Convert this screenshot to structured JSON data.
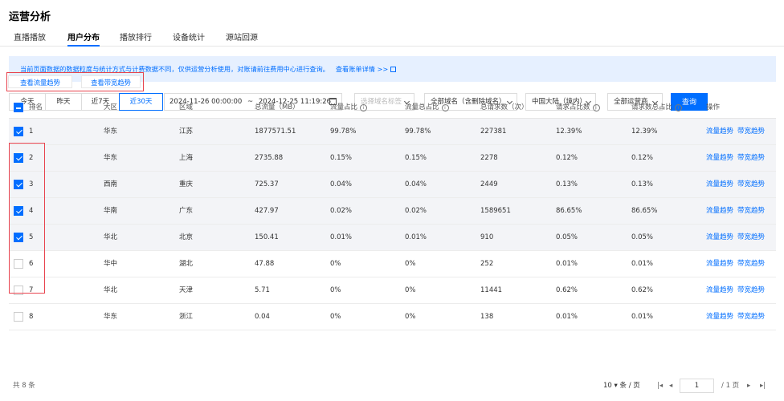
{
  "header": {
    "title": "运营分析",
    "tabs": [
      {
        "label": "直播播放",
        "active": false
      },
      {
        "label": "用户分布",
        "active": true
      },
      {
        "label": "播放排行",
        "active": false
      },
      {
        "label": "设备统计",
        "active": false
      },
      {
        "label": "源站回源",
        "active": false
      }
    ]
  },
  "notice": {
    "text": "当前页面数据的数据粒度与统计方式与计费数据不同，仅供运营分析使用，对账请前往费用中心进行查询。",
    "link": "查看账单详情 >>"
  },
  "filters": {
    "quick_ranges": [
      {
        "label": "今天",
        "active": false
      },
      {
        "label": "昨天",
        "active": false
      },
      {
        "label": "近7天",
        "active": false
      },
      {
        "label": "近30天",
        "active": true
      }
    ],
    "date_start": "2024-11-26 00:00:00",
    "date_sep": "~",
    "date_end": "2024-12-25 11:19:26",
    "tag_placeholder": "选择域名标签",
    "domain_select": "全部域名（含删除域名）",
    "region_select": "中国大陆（境内）",
    "isp_select": "全部运营商",
    "query_label": "查询"
  },
  "trend_buttons": {
    "traffic": "查看流量趋势",
    "bandwidth": "查看带宽趋势"
  },
  "table": {
    "columns": [
      "排名",
      "大区",
      "区域",
      "总流量（MB）",
      "流量占比",
      "流量总占比",
      "总请求数（次）",
      "请求占比数",
      "请求数总占比",
      "操作"
    ],
    "op_traffic": "流量趋势",
    "op_bandwidth": "带宽趋势",
    "info_glyph": "i",
    "rows": [
      {
        "rank": "1",
        "area": "华东",
        "region": "江苏",
        "traffic": "1877571.51",
        "traffic_ratio": "99.78%",
        "traffic_total_ratio": "99.78%",
        "requests": "227381",
        "req_ratio": "12.39%",
        "req_total_ratio": "12.39%",
        "checked": true
      },
      {
        "rank": "2",
        "area": "华东",
        "region": "上海",
        "traffic": "2735.88",
        "traffic_ratio": "0.15%",
        "traffic_total_ratio": "0.15%",
        "requests": "2278",
        "req_ratio": "0.12%",
        "req_total_ratio": "0.12%",
        "checked": true
      },
      {
        "rank": "3",
        "area": "西南",
        "region": "重庆",
        "traffic": "725.37",
        "traffic_ratio": "0.04%",
        "traffic_total_ratio": "0.04%",
        "requests": "2449",
        "req_ratio": "0.13%",
        "req_total_ratio": "0.13%",
        "checked": true
      },
      {
        "rank": "4",
        "area": "华南",
        "region": "广东",
        "traffic": "427.97",
        "traffic_ratio": "0.02%",
        "traffic_total_ratio": "0.02%",
        "requests": "1589651",
        "req_ratio": "86.65%",
        "req_total_ratio": "86.65%",
        "checked": true
      },
      {
        "rank": "5",
        "area": "华北",
        "region": "北京",
        "traffic": "150.41",
        "traffic_ratio": "0.01%",
        "traffic_total_ratio": "0.01%",
        "requests": "910",
        "req_ratio": "0.05%",
        "req_total_ratio": "0.05%",
        "checked": true
      },
      {
        "rank": "6",
        "area": "华中",
        "region": "湖北",
        "traffic": "47.88",
        "traffic_ratio": "0%",
        "traffic_total_ratio": "0%",
        "requests": "252",
        "req_ratio": "0.01%",
        "req_total_ratio": "0.01%",
        "checked": false
      },
      {
        "rank": "7",
        "area": "华北",
        "region": "天津",
        "traffic": "5.71",
        "traffic_ratio": "0%",
        "traffic_total_ratio": "0%",
        "requests": "11441",
        "req_ratio": "0.62%",
        "req_total_ratio": "0.62%",
        "checked": false
      },
      {
        "rank": "8",
        "area": "华东",
        "region": "浙江",
        "traffic": "0.04",
        "traffic_ratio": "0%",
        "traffic_total_ratio": "0%",
        "requests": "138",
        "traffic_dummy": "",
        "req_ratio": "0.01%",
        "req_total_ratio": "0.01%",
        "checked": false
      }
    ]
  },
  "footer": {
    "total": "共 8 条",
    "page_size": "10",
    "page_size_unit": "条 / 页",
    "first": "|◂",
    "prev": "◂",
    "current_page": "1",
    "page_total": "/ 1 页",
    "next": "▸",
    "last": "▸|"
  },
  "colors": {
    "primary": "#006eff",
    "highlight_border": "#e8434e",
    "notice_bg": "#e6f0ff"
  }
}
